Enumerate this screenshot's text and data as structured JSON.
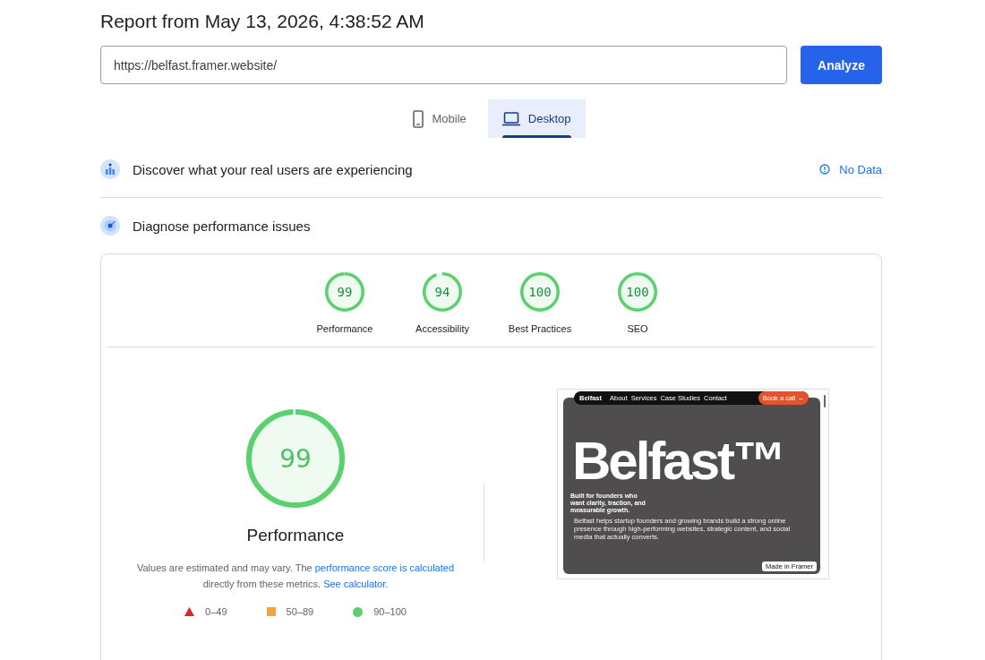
{
  "report_title": "Report from May 13, 2026, 4:38:52 AM",
  "url_field": {
    "value": "https://belfast.framer.website/"
  },
  "analyze_button": "Analyze",
  "device_tabs": [
    {
      "label": "Mobile",
      "kind": "phone",
      "selected": false
    },
    {
      "label": "Desktop",
      "kind": "laptop",
      "selected": true
    }
  ],
  "sections": [
    {
      "kind": "users",
      "title": "Discover what your real users are experiencing",
      "status": "No Data"
    },
    {
      "kind": "diagnose",
      "title": "Diagnose performance issues"
    }
  ],
  "categories": [
    {
      "label": "Performance",
      "score": "99",
      "level": 0.99
    },
    {
      "label": "Accessibility",
      "score": "94",
      "level": 0.94
    },
    {
      "label": "Best Practices",
      "score": "100",
      "level": 1
    },
    {
      "label": "SEO",
      "score": "100",
      "level": 1
    }
  ],
  "main_score": {
    "score": "99",
    "level": 0.99,
    "title": "Performance",
    "note": [
      {
        "text": "Values are estimated and may vary. The ",
        "kind": "text"
      },
      {
        "text": "performance score is calculated",
        "kind": "link"
      },
      {
        "text": " directly from these metrics. ",
        "kind": "text"
      },
      {
        "text": "See calculator.",
        "kind": "link"
      }
    ],
    "legend": [
      {
        "kind": "triangle",
        "label": "0–49",
        "color": "#e02424"
      },
      {
        "kind": "square",
        "label": "50–89",
        "color": "#f0a742"
      },
      {
        "kind": "circle",
        "label": "90–100",
        "color": "#5ad16e"
      }
    ]
  },
  "page_screenshot": {
    "nav": {
      "brand": "Belfast",
      "links": [
        "About",
        "Services",
        "Case Studies",
        "Contact"
      ],
      "cta": "Book a call →"
    },
    "headline": "Belfast™",
    "tagline": "Built for founders who want clarity, traction, and measurable growth.",
    "body": "Belfast helps startup founders and growing brands build a strong online presence through high-performing websites, strategic content, and social media that actually converts.",
    "badge": "Made in Framer"
  }
}
